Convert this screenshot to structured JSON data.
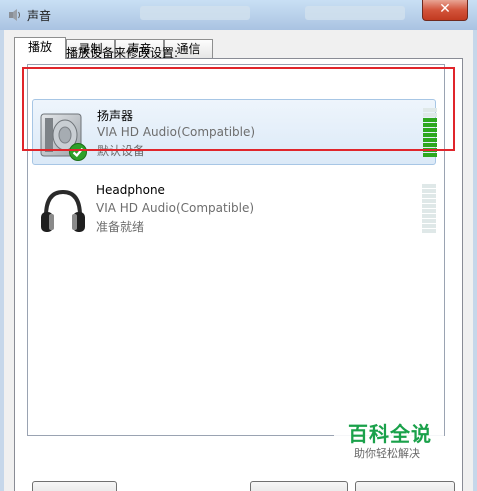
{
  "window": {
    "title": "声音",
    "close_label": "✕"
  },
  "tabs": [
    {
      "label": "播放",
      "active": true
    },
    {
      "label": "录制",
      "active": false
    },
    {
      "label": "声音",
      "active": false
    },
    {
      "label": "通信",
      "active": false
    }
  ],
  "instruction": "选择以下播放设备来修改设置:",
  "devices": [
    {
      "name": "扬声器",
      "driver": "VIA HD Audio(Compatible)",
      "status": "默认设备",
      "icon": "speaker-icon",
      "badge": "default-check-icon",
      "selected": true,
      "meter_level": 0.75
    },
    {
      "name": "Headphone",
      "driver": "VIA HD Audio(Compatible)",
      "status": "准备就绪",
      "icon": "headphone-icon",
      "selected": false,
      "meter_level": 0
    }
  ],
  "colors": {
    "highlight": "#e0252b",
    "meter_active": "#2ea81f",
    "watermark": "#1aa14a"
  },
  "watermark": {
    "title": "百科全说",
    "subtitle": "助你轻松解决"
  }
}
